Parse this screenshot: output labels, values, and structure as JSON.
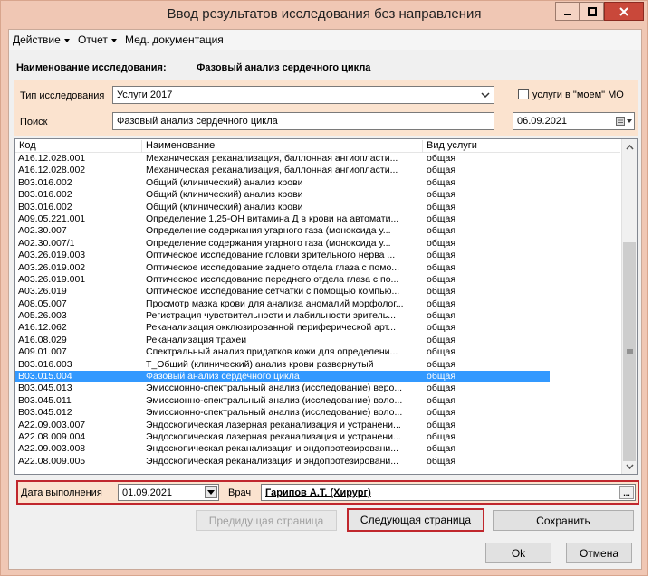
{
  "window": {
    "title": "Ввод результатов исследования без направления"
  },
  "menu": {
    "action": "Действие",
    "report": "Отчет",
    "med_docs": "Мед. документация"
  },
  "exam": {
    "label": "Наименование исследования:",
    "value": "Фазовый анализ сердечного цикла"
  },
  "filters": {
    "type_label": "Тип исследования",
    "type_value": "Услуги 2017",
    "own_mo_label": "услуги в \"моем\" МО",
    "own_mo_checked": false,
    "search_label": "Поиск",
    "search_value": "Фазовый анализ сердечного цикла",
    "date_value": "06.09.2021"
  },
  "table": {
    "columns": [
      "Код",
      "Наименование",
      "Вид услуги"
    ],
    "selected_index": 19,
    "rows": [
      [
        "A16.12.028.001",
        "Механическая реканализация, баллонная ангиопласти...",
        "общая"
      ],
      [
        "A16.12.028.002",
        "Механическая реканализация, баллонная ангиопласти...",
        "общая"
      ],
      [
        "B03.016.002",
        "Общий (клинический) анализ крови",
        "общая"
      ],
      [
        "B03.016.002",
        "Общий (клинический) анализ крови",
        "общая"
      ],
      [
        "B03.016.002",
        "Общий (клинический) анализ крови",
        "общая"
      ],
      [
        "A09.05.221.001",
        "Определение 1,25-OH витамина Д в крови на автомати...",
        "общая"
      ],
      [
        "A02.30.007",
        "Определение содержания угарного газа (моноксида у...",
        "общая"
      ],
      [
        "A02.30.007/1",
        "Определение содержания угарного газа (моноксида у...",
        "общая"
      ],
      [
        "A03.26.019.003",
        "Оптическое исследование головки зрительного нерва ...",
        "общая"
      ],
      [
        "A03.26.019.002",
        "Оптическое исследование заднего отдела глаза с помо...",
        "общая"
      ],
      [
        "A03.26.019.001",
        "Оптическое исследование переднего отдела глаза с по...",
        "общая"
      ],
      [
        "A03.26.019",
        "Оптическое исследование сетчатки с помощью компью...",
        "общая"
      ],
      [
        "A08.05.007",
        "Просмотр мазка крови для анализа аномалий морфолог...",
        "общая"
      ],
      [
        "A05.26.003",
        "Регистрация чувствительности и лабильности зритель...",
        "общая"
      ],
      [
        "A16.12.062",
        "Реканализация окклюзированной периферической арт...",
        "общая"
      ],
      [
        "A16.08.029",
        "Реканализация трахеи",
        "общая"
      ],
      [
        "A09.01.007",
        "Спектральный анализ придатков кожи для определени...",
        "общая"
      ],
      [
        "B03.016.003",
        "Т_Общий (клинический) анализ крови развернутый",
        "общая"
      ],
      [
        "B03.015.004",
        "Фазовый анализ сердечного цикла",
        "общая"
      ],
      [
        "B03.045.013",
        "Эмиссионно-спектральный анализ (исследование) веро...",
        "общая"
      ],
      [
        "B03.045.011",
        "Эмиссионно-спектральный анализ (исследование) воло...",
        "общая"
      ],
      [
        "B03.045.012",
        "Эмиссионно-спектральный анализ (исследование) воло...",
        "общая"
      ],
      [
        "A22.09.003.007",
        "Эндоскопическая лазерная реканализация и устранени...",
        "общая"
      ],
      [
        "A22.08.009.004",
        "Эндоскопическая лазерная реканализация и устранени...",
        "общая"
      ],
      [
        "A22.09.003.008",
        "Эндоскопическая реканализация и эндопротезировани...",
        "общая"
      ],
      [
        "A22.08.009.005",
        "Эндоскопическая реканализация и эндопротезировани...",
        "общая"
      ]
    ]
  },
  "execution": {
    "date_label": "Дата выполнения",
    "date_value": "01.09.2021",
    "doctor_label": "Врач",
    "doctor_value": "Гарипов А.Т. (Хирург)",
    "ellipsis": "..."
  },
  "buttons": {
    "prev_page": "Предидущая страница",
    "next_page": "Следующая страница",
    "save": "Сохранить",
    "ok": "Ok",
    "cancel": "Отмена"
  },
  "colors": {
    "window_frame": "#f0c7b4",
    "panel_bg": "#fbe3cf",
    "selection": "#3399ff",
    "highlight_border": "#c0272d",
    "close_button": "#c9483a"
  }
}
